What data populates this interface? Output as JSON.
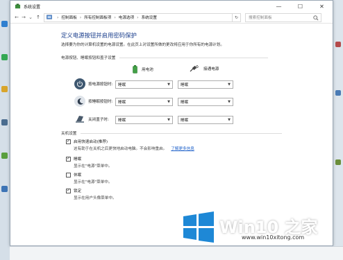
{
  "window": {
    "title": "系统设置",
    "controls": {
      "minimize": "—",
      "maximize": "☐",
      "close": "✕"
    }
  },
  "address": {
    "breadcrumbs": [
      "控制面板",
      "所有控制面板项",
      "电源选项",
      "系统设置"
    ],
    "search_placeholder": "搜索控制面板",
    "refresh": "↻"
  },
  "page": {
    "title": "定义电源按钮并启用密码保护",
    "description": "选择要为你的计算机设置的电源设置。在此页上对设置所做的更改将应用于你所有的电源计划。",
    "section_buttons": "电源按钮、睡眠按钮和盖子设置",
    "col_battery": "用电池",
    "col_plugged": "接通电源",
    "rows": [
      {
        "label": "按电源按钮时:",
        "battery": "睡眠",
        "plugged": "睡眠",
        "icon": "power-icon"
      },
      {
        "label": "按睡眠按钮时:",
        "battery": "睡眠",
        "plugged": "睡眠",
        "icon": "moon-icon"
      },
      {
        "label": "关闭盖子时:",
        "battery": "睡眠",
        "plugged": "睡眠",
        "icon": "laptop-lid-icon"
      }
    ],
    "section_shutdown": "关机设置",
    "shutdown": [
      {
        "label": "启用快速启动(推荐)",
        "checked": true,
        "desc": "这有助于在关机之后更快地启动电脑。不会影响重启。",
        "link": "了解更多信息"
      },
      {
        "label": "睡眠",
        "checked": true,
        "desc": "显示在\"电源\"菜单中。"
      },
      {
        "label": "休眠",
        "checked": false,
        "desc": "显示在\"电源\"菜单中。"
      },
      {
        "label": "锁定",
        "checked": true,
        "desc": "显示在用户头像菜单中。"
      }
    ]
  },
  "watermark": {
    "brand": "Win10 之家",
    "url": "www.win10xitong.com"
  },
  "colors": {
    "title_blue": "#1a3e8c",
    "link_blue": "#1a5ec9",
    "logo_blue": "#1e88d6"
  }
}
